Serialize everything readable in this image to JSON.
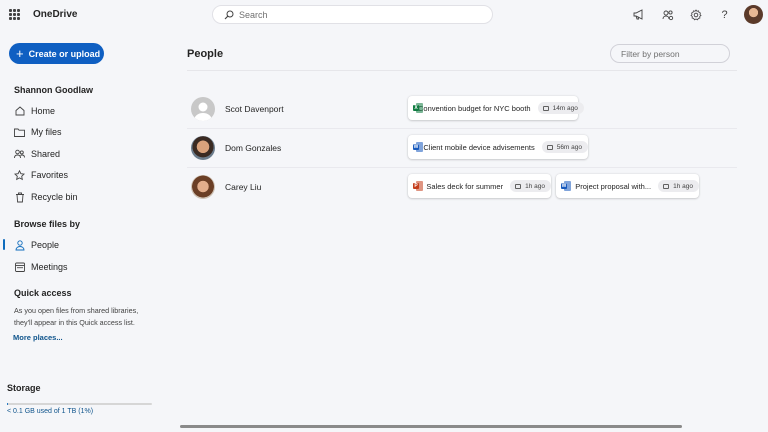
{
  "header": {
    "app_title": "OneDrive",
    "search_placeholder": "Search",
    "icons": [
      "waffle-icon",
      "megaphone-icon",
      "people-settings-icon",
      "gear-icon",
      "help-icon"
    ]
  },
  "sidebar": {
    "create_label": "Create or upload",
    "user_name": "Shannon Goodlaw",
    "nav": [
      {
        "label": "Home",
        "icon": "home-icon"
      },
      {
        "label": "My files",
        "icon": "folder-icon"
      },
      {
        "label": "Shared",
        "icon": "shared-icon"
      },
      {
        "label": "Favorites",
        "icon": "star-icon"
      },
      {
        "label": "Recycle bin",
        "icon": "trash-icon"
      }
    ],
    "browse_title": "Browse files by",
    "browse": [
      {
        "label": "People",
        "icon": "person-icon",
        "active": true
      },
      {
        "label": "Meetings",
        "icon": "calendar-icon",
        "active": false
      }
    ],
    "quick_access_title": "Quick access",
    "quick_access_text": "As you open files from shared libraries, they'll appear in this Quick access list.",
    "more_places": "More places...",
    "storage_title": "Storage",
    "storage_text": "< 0.1 GB used of 1 TB (1%)",
    "storage_fraction": 0.01
  },
  "main": {
    "title": "People",
    "filter_placeholder": "Filter by person",
    "people": [
      {
        "name": "Scot Davenport",
        "files": [
          {
            "name": "Convention budget for NYC booth",
            "time": "14m ago",
            "type": "excel"
          }
        ]
      },
      {
        "name": "Dom Gonzales",
        "files": [
          {
            "name": "Client mobile device advisements",
            "time": "56m ago",
            "type": "word"
          }
        ]
      },
      {
        "name": "Carey Liu",
        "files": [
          {
            "name": "Sales deck for summer",
            "time": "1h ago",
            "type": "powerpoint"
          },
          {
            "name": "Project proposal with...",
            "time": "1h ago",
            "type": "word"
          }
        ]
      }
    ]
  },
  "colors": {
    "accent": "#0f6cbd",
    "create_button": "#0f5fc2",
    "excel": "#107c41",
    "word": "#185abd",
    "powerpoint": "#c43e1c"
  }
}
